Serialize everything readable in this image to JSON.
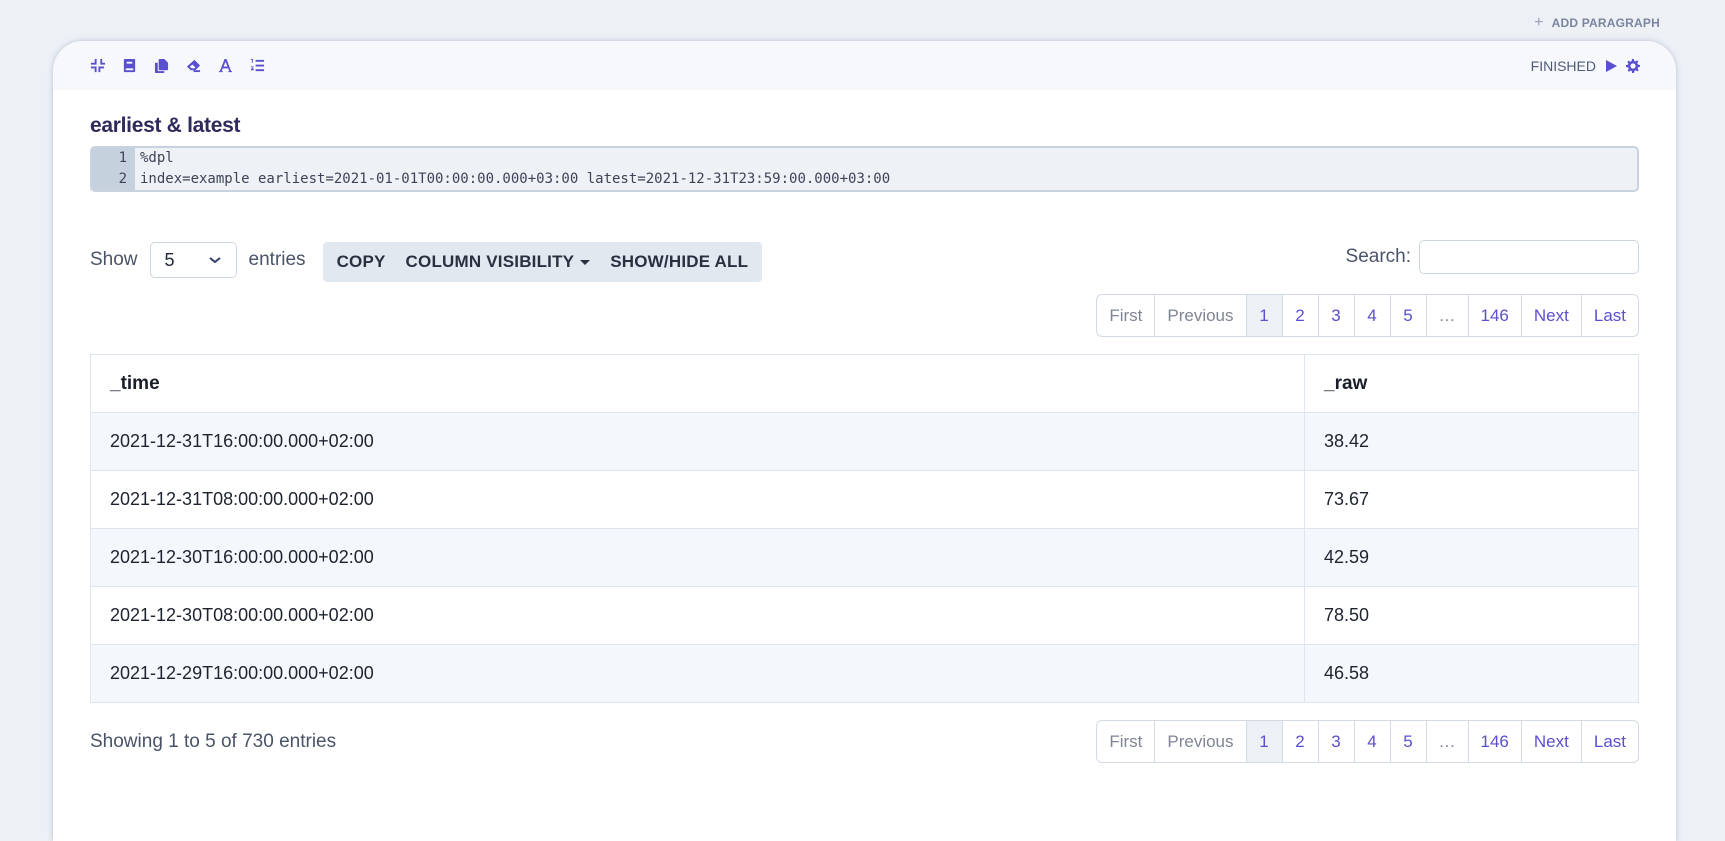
{
  "add_paragraph": {
    "icon": "plus-icon",
    "label": "ADD PARAGRAPH"
  },
  "toolbar": {
    "icons": [
      "compress-icon",
      "book-icon",
      "copy-icon",
      "eraser-icon",
      "font-icon",
      "ordered-list-icon"
    ]
  },
  "status": {
    "label": "FINISHED",
    "run_icon": "play-icon",
    "settings_icon": "gear-icon"
  },
  "paragraph": {
    "title": "earliest & latest",
    "code_lines": [
      {
        "n": "1",
        "text": "%dpl"
      },
      {
        "n": "2",
        "text": "index=example earliest=2021-01-01T00:00:00.000+03:00 latest=2021-12-31T23:59:00.000+03:00"
      }
    ]
  },
  "table_controls": {
    "show_label": "Show",
    "entries_value": "5",
    "entries_label": "entries",
    "buttons": {
      "copy": "COPY",
      "column_visibility": "COLUMN VISIBILITY",
      "show_hide_all": "SHOW/HIDE ALL"
    },
    "search_label": "Search:",
    "search_value": "",
    "search_placeholder": ""
  },
  "pagination": {
    "first": "First",
    "previous": "Previous",
    "pages": [
      "1",
      "2",
      "3",
      "4",
      "5"
    ],
    "ellipsis": "…",
    "last_page": "146",
    "next": "Next",
    "last": "Last",
    "current": "1"
  },
  "table": {
    "columns": [
      "_time",
      "_raw"
    ],
    "rows": [
      [
        "2021-12-31T16:00:00.000+02:00",
        "38.42"
      ],
      [
        "2021-12-31T08:00:00.000+02:00",
        "73.67"
      ],
      [
        "2021-12-30T16:00:00.000+02:00",
        "42.59"
      ],
      [
        "2021-12-30T08:00:00.000+02:00",
        "78.50"
      ],
      [
        "2021-12-29T16:00:00.000+02:00",
        "46.58"
      ]
    ]
  },
  "info": "Showing 1 to 5 of 730 entries"
}
